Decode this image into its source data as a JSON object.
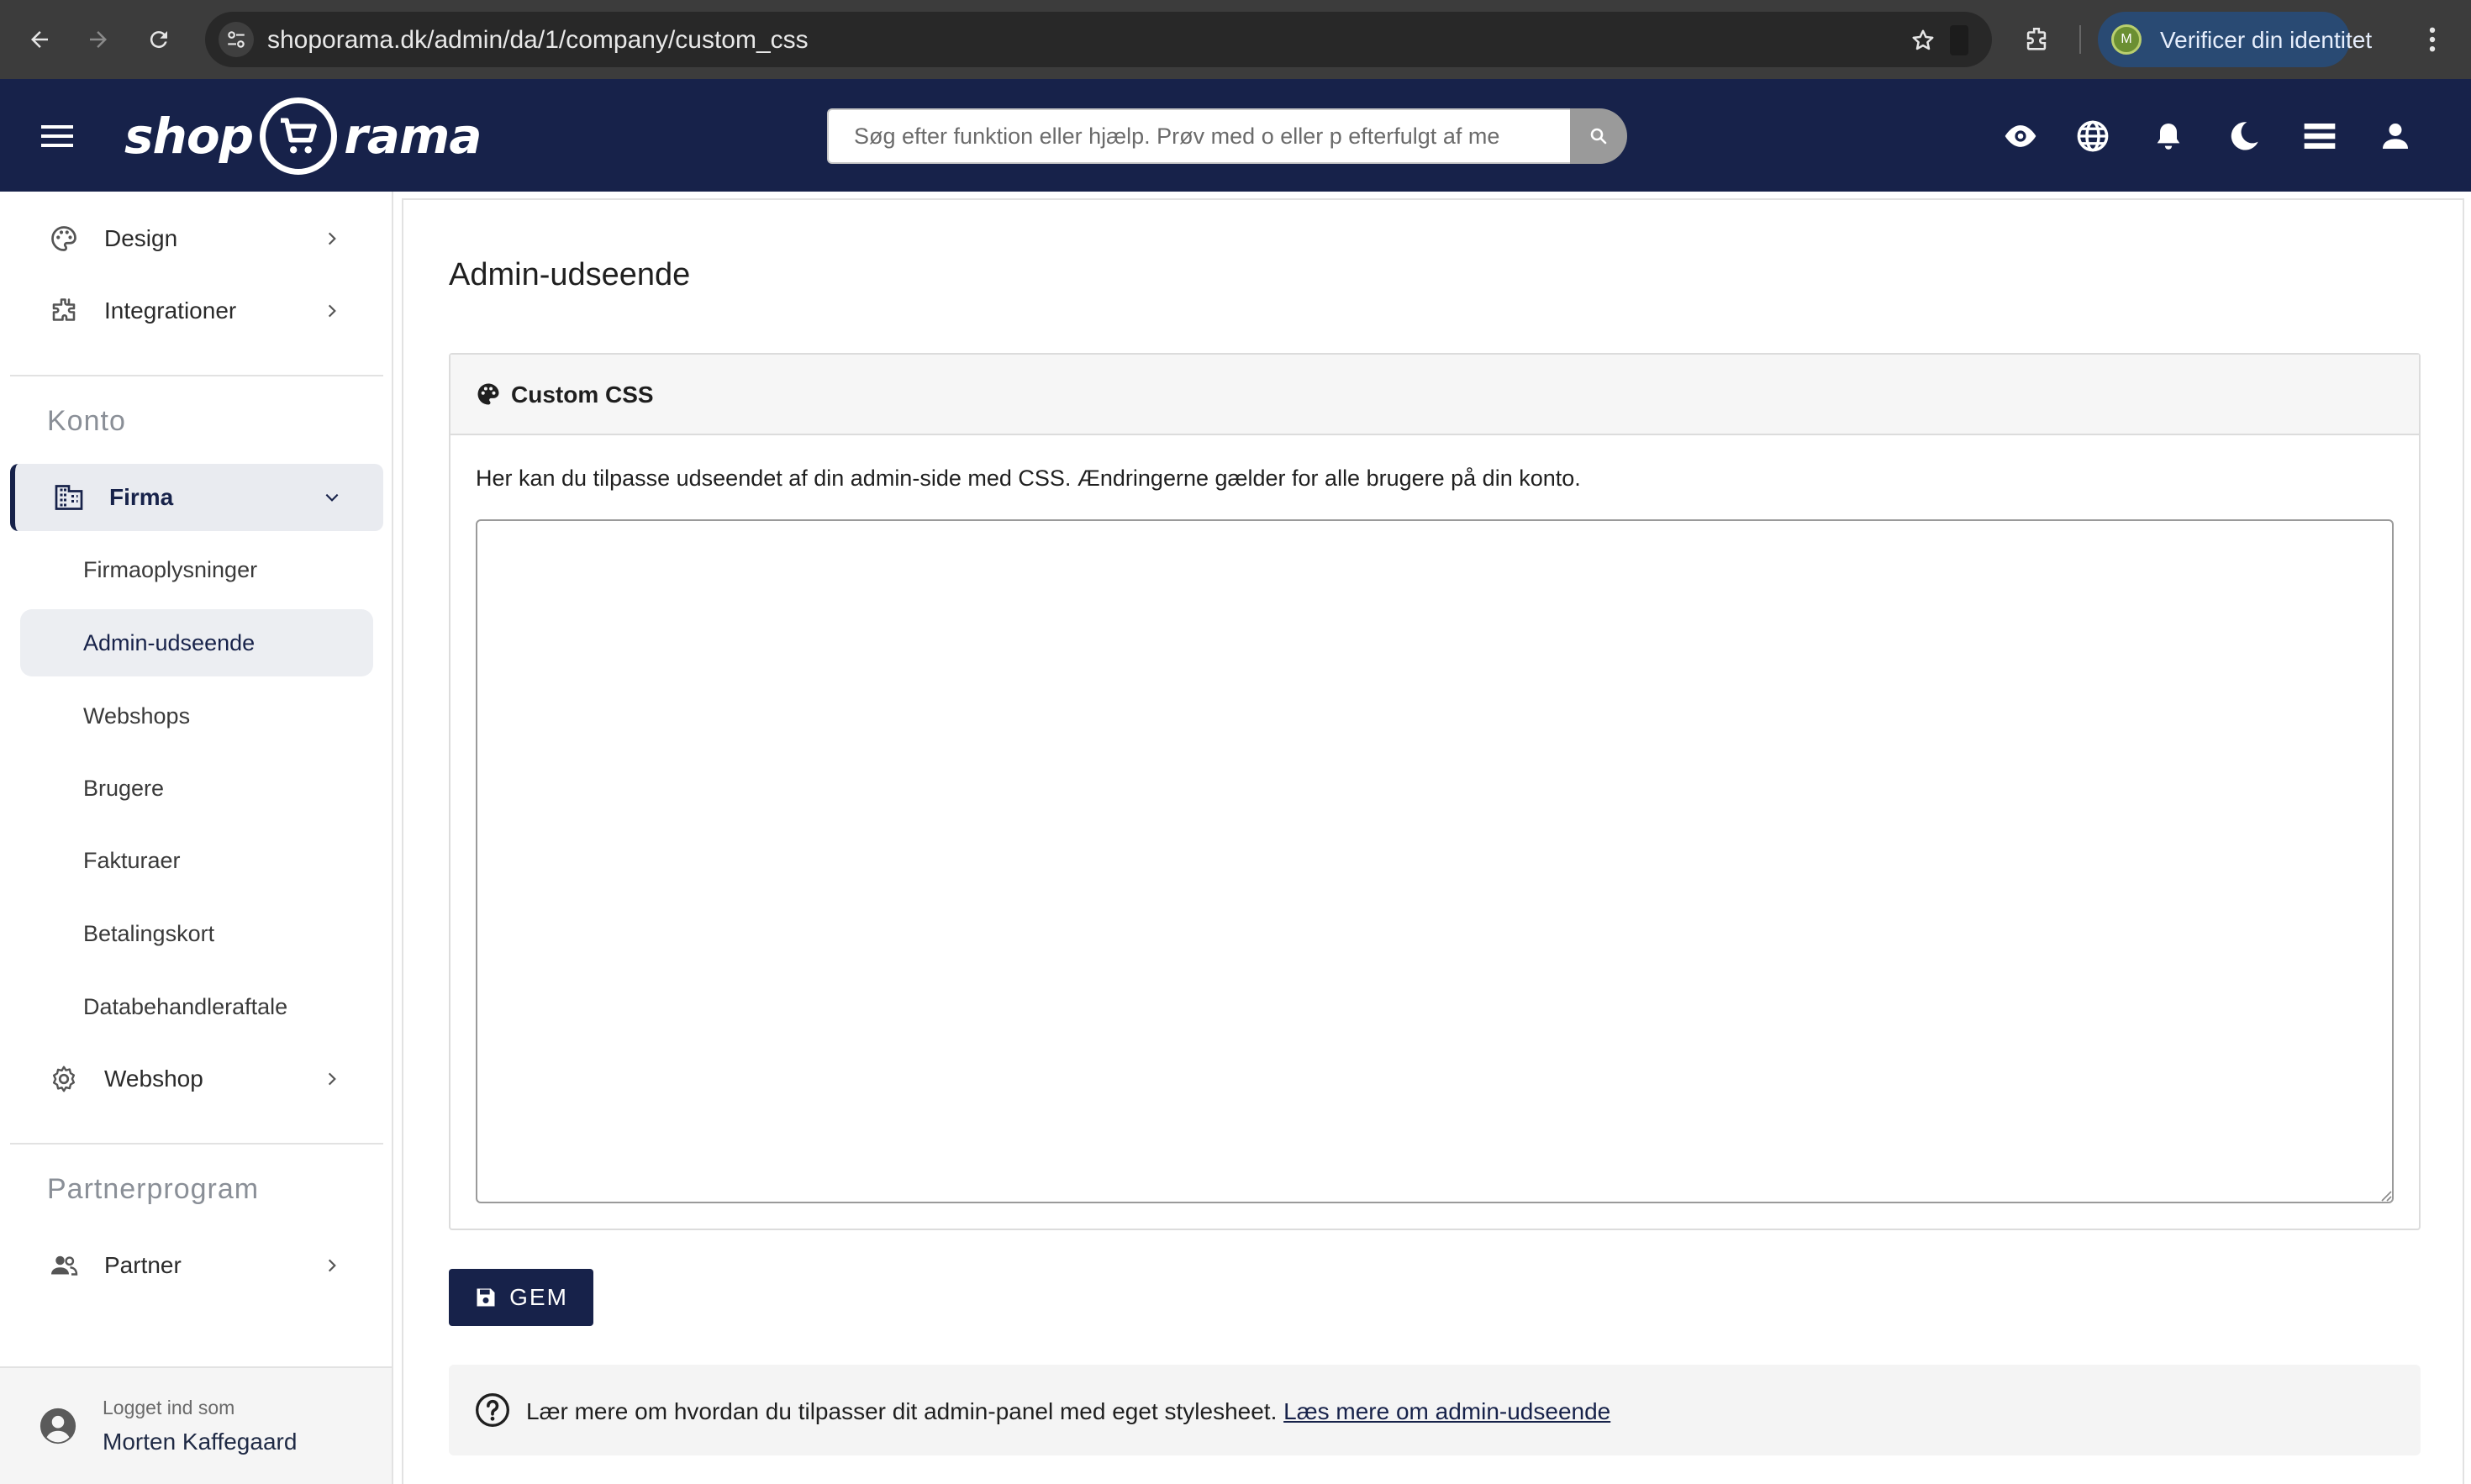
{
  "browser": {
    "url": "shoporama.dk/admin/da/1/company/custom_css",
    "profile_initial": "M",
    "profile_button": "Verificer din identitet"
  },
  "header": {
    "logo_left": "shop",
    "logo_right": "rama",
    "search_placeholder": "Søg efter funktion eller hjælp. Prøv med o eller p efterfulgt af me",
    "icons": [
      "eye-icon",
      "globe-icon",
      "bell-icon",
      "moon-icon",
      "stack-icon",
      "person-icon"
    ]
  },
  "sidebar": {
    "top_items": [
      {
        "label": "Design",
        "icon": "palette-icon"
      },
      {
        "label": "Integrationer",
        "icon": "puzzle-icon"
      }
    ],
    "section_account": "Konto",
    "firma": {
      "label": "Firma",
      "icon": "building-icon"
    },
    "sub_items": [
      {
        "label": "Firmaoplysninger"
      },
      {
        "label": "Admin-udseende",
        "selected": true
      },
      {
        "label": "Webshops"
      },
      {
        "label": "Brugere"
      },
      {
        "label": "Fakturaer"
      },
      {
        "label": "Betalingskort"
      },
      {
        "label": "Databehandleraftale"
      }
    ],
    "webshop": {
      "label": "Webshop",
      "icon": "gear-icon"
    },
    "section_partner": "Partnerprogram",
    "partner": {
      "label": "Partner",
      "icon": "people-icon"
    },
    "user": {
      "logged_in_label": "Logget ind som",
      "name": "Morten Kaffegaard"
    }
  },
  "main": {
    "page_title": "Admin-udseende",
    "card_title": "Custom CSS",
    "description": "Her kan du tilpasse udseendet af din admin-side med CSS. Ændringerne gælder for alle brugere på din konto.",
    "editor_value": "",
    "save_label": "GEM",
    "info_text": "Lær mere om hvordan du tilpasser dit admin-panel med eget stylesheet.",
    "info_link": "Læs mere om admin-udseende"
  },
  "colors": {
    "brand_navy": "#17224a",
    "verify_blue": "#294a73"
  }
}
